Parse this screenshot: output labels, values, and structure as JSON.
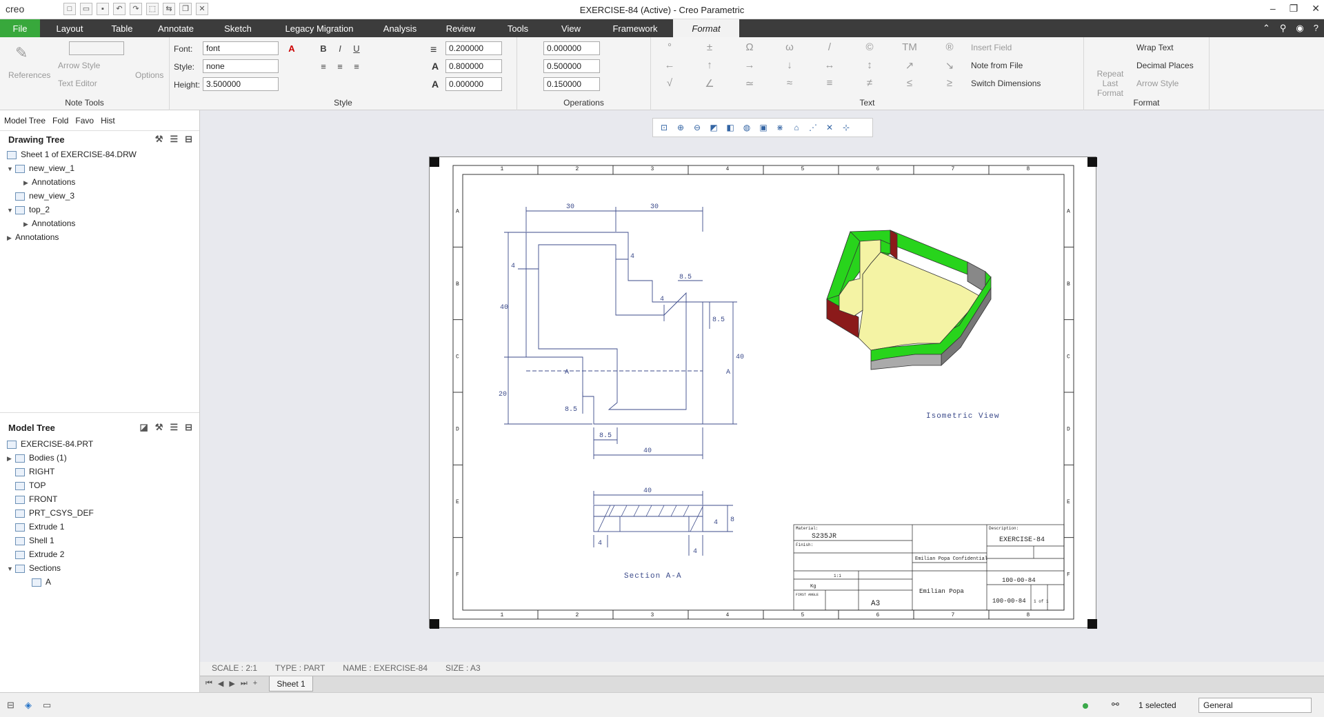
{
  "window": {
    "title": "EXERCISE-84 (Active) - Creo Parametric",
    "app_logo": "creo"
  },
  "menu": {
    "tabs": [
      "File",
      "Layout",
      "Table",
      "Annotate",
      "Sketch",
      "Legacy Migration",
      "Analysis",
      "Review",
      "Tools",
      "View",
      "Framework",
      "Format"
    ],
    "active": "Format"
  },
  "ribbon": {
    "note_tools": {
      "label": "Note Tools",
      "references": "References",
      "arrow_style": "Arrow Style",
      "text_editor": "Text Editor",
      "options": "Options"
    },
    "style": {
      "label": "Style",
      "font_label": "Font:",
      "font_value": "font",
      "style_label": "Style:",
      "style_value": "none",
      "height_label": "Height:",
      "height_value": "3.500000"
    },
    "operations": {
      "label": "Operations",
      "v1": "0.200000",
      "v2": "0.800000",
      "v3": "0.000000",
      "v4": "0.000000",
      "v5": "0.500000",
      "v6": "0.150000"
    },
    "text": {
      "label": "Text",
      "insert_field": "Insert Field",
      "note_from_file": "Note from File",
      "switch_dimensions": "Switch Dimensions",
      "symbols": [
        "°",
        "±",
        "Ω",
        "ω",
        "/",
        "©",
        "TM",
        "®",
        "←",
        "↑",
        "→",
        "↓",
        "↔",
        "↕",
        "↗",
        "↘",
        "√",
        "∠",
        "≃",
        "≈",
        "≡",
        "≠",
        "≤",
        "≥"
      ]
    },
    "format": {
      "label": "Format",
      "repeat_last_format": "Repeat Last Format",
      "wrap_text": "Wrap Text",
      "decimal_places": "Decimal Places",
      "arrow_style": "Arrow Style"
    }
  },
  "left_panel": {
    "tabs": [
      "Model Tree",
      "Fold",
      "Favo",
      "Hist"
    ],
    "drawing_tree": {
      "title": "Drawing Tree",
      "items": [
        "Sheet 1 of EXERCISE-84.DRW",
        "new_view_1",
        "Annotations",
        "new_view_3",
        "top_2",
        "Annotations",
        "Annotations"
      ]
    },
    "model_tree": {
      "title": "Model Tree",
      "items": [
        "EXERCISE-84.PRT",
        "Bodies (1)",
        "RIGHT",
        "TOP",
        "FRONT",
        "PRT_CSYS_DEF",
        "Extrude 1",
        "Shell 1",
        "Extrude 2",
        "Sections",
        "A"
      ]
    }
  },
  "drawing": {
    "border_cols": [
      "1",
      "2",
      "3",
      "4",
      "5",
      "6",
      "7",
      "8"
    ],
    "border_rows": [
      "A",
      "B",
      "C",
      "D",
      "E",
      "F"
    ],
    "dims": {
      "d30a": "30",
      "d30b": "30",
      "d4a": "4",
      "d4b": "4",
      "d4c": "4",
      "d85a": "8.5",
      "d85b": "8.5",
      "d85c": "8.5",
      "d85d": "8.5",
      "d40a": "40",
      "d40b": "40",
      "d40c": "40",
      "d20": "20",
      "d40top": "40",
      "d8": "8",
      "d4s1": "4",
      "d4s2": "4",
      "d4s3": "4",
      "secA1": "A",
      "secA2": "A"
    },
    "labels": {
      "isometric": "Isometric View",
      "section": "Section A-A"
    },
    "title_block": {
      "material_label": "Material:",
      "material": "S235JR",
      "finish_label": "Finish:",
      "description_label": "Description:",
      "description": "EXERCISE-84",
      "confidential": "Emilian Popa Confidential",
      "scale": "1:1",
      "size": "A3",
      "part_number": "100-00-84",
      "drawing_number": "100-00-84",
      "sheet": "1 of 1",
      "owner": "Emilian Popa",
      "weight": "Kg",
      "projection": "FIRST ANGLE"
    }
  },
  "info_bar": {
    "scale": "SCALE : 2:1",
    "type": "TYPE : PART",
    "name": "NAME : EXERCISE-84",
    "size": "SIZE : A3"
  },
  "sheet_tab": "Sheet 1",
  "status": {
    "selected": "1 selected",
    "filter": "General"
  }
}
